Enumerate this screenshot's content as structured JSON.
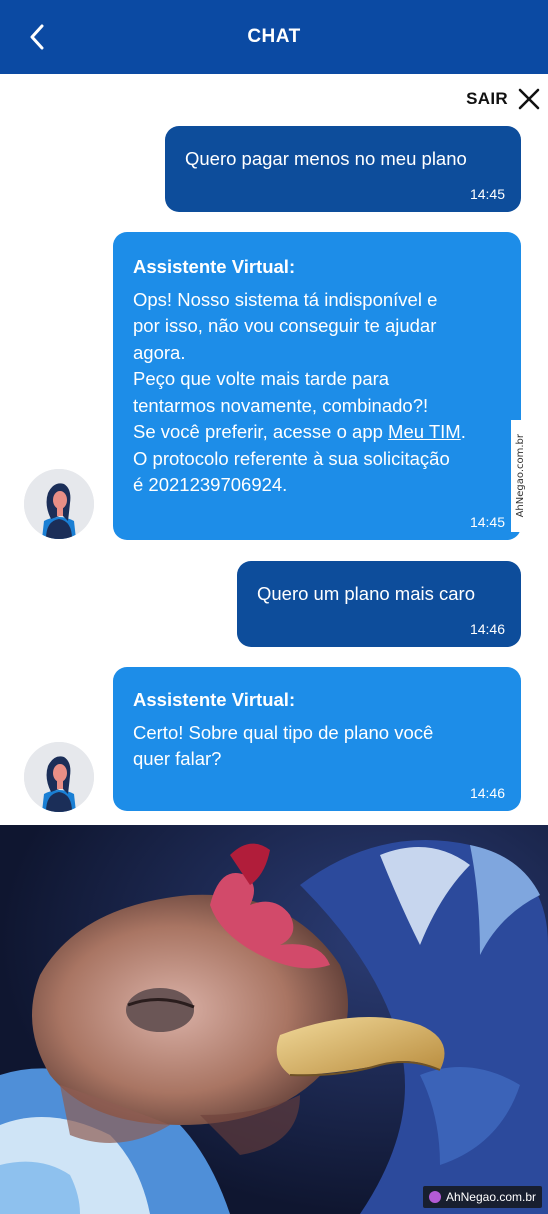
{
  "header": {
    "title": "CHAT",
    "back_icon": "chevron-left-icon"
  },
  "toolbar": {
    "exit_label": "SAIR",
    "exit_icon": "close-icon"
  },
  "messages": [
    {
      "from": "user",
      "text": "Quero pagar menos no meu plano",
      "time": "14:45"
    },
    {
      "from": "bot",
      "sender": "Assistente Virtual:",
      "text_before_link": "Ops! Nosso sistema tá indisponível e\npor isso, não vou conseguir te ajudar\nagora.\nPeço que volte mais tarde para\ntentarmos novamente, combinado?!\nSe você preferir, acesse o app ",
      "link": "Meu TIM",
      "text_after_link": ".\nO protocolo referente à sua solicitação\né 2021239706924.",
      "time": "14:45"
    },
    {
      "from": "user",
      "text": "Quero um plano mais caro",
      "time": "14:46"
    },
    {
      "from": "bot",
      "sender": "Assistente Virtual:",
      "text": "Certo! Sobre qual tipo de plano você\nquer falar?",
      "time": "14:46"
    }
  ],
  "watermarks": {
    "side": "AhNegao.com.br",
    "bottom": "AhNegao.com.br"
  },
  "colors": {
    "header": "#0b4aa3",
    "user_bubble": "#0d4d9b",
    "bot_bubble": "#1d8de8"
  }
}
